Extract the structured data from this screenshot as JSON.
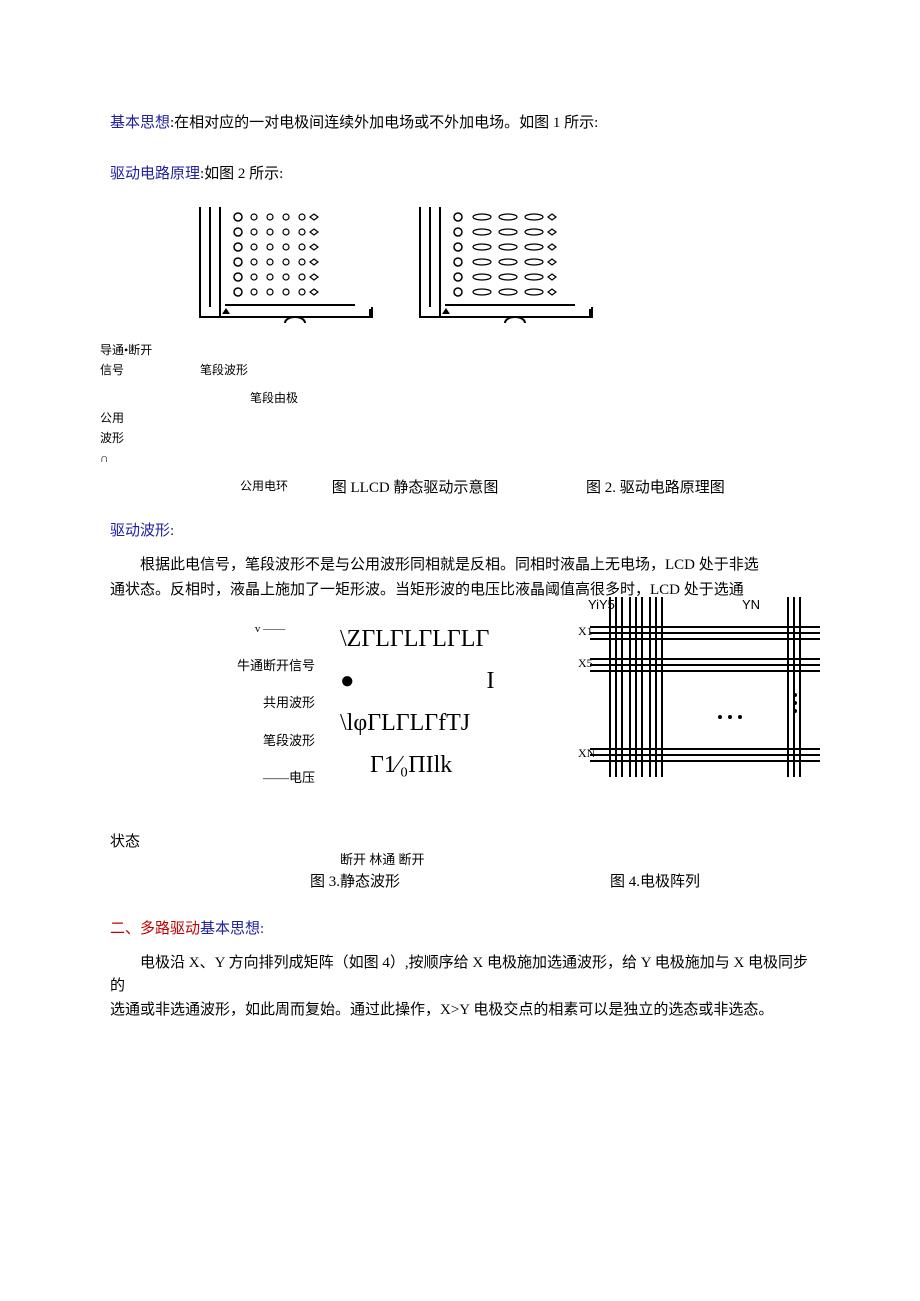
{
  "p1": {
    "label": "基本思想",
    "text": ":在相对应的一对电极间连续外加电场或不外加电场。如图 1 所示:"
  },
  "p2": {
    "label": "驱动电路原理",
    "text": ":如图 2 所示:"
  },
  "below": {
    "l1a": "导通•断开",
    "l1b": "信号",
    "l2": "笔段波形",
    "l3a": "公用",
    "l3b": "波形",
    "l3c": "∩",
    "l4": "笔段由极"
  },
  "caption12": {
    "gongyong": "公用电环",
    "c1": "图 LLCD 静态驱动示意图",
    "c2": "图 2. 驱动电路原理图"
  },
  "p3": "驱动波形:",
  "p4": "根据此电信号，笔段波形不是与公用波形同相就是反相。同相时液晶上无电场，LCD 处于非选",
  "p4b": "通状态。反相时，液晶上施加了一矩形波。当矩形波的电压比液晶阈值高很多时，LCD 处于选通",
  "fig3": {
    "top_v": "v ——",
    "l1": "牛通断开信号",
    "l2": "共用波形",
    "l3": "笔段波形",
    "l4": "——电压",
    "state": "状态",
    "sym1": "\\ΖΓLΓLΓLΓLΓ",
    "dot": "●",
    "sym_i": "I",
    "sym2": "\\lφΓLΓLΓfTJ",
    "sym3": "Γ1⁄₀ΠIlk",
    "break_label": "断开 林通 断开",
    "y_left": "YiY5",
    "y_right": "YN",
    "x1": "X1",
    "x5": "X5",
    "xn": "XN"
  },
  "caption34": {
    "c3": "图 3.静态波形",
    "c4": "图 4.电极阵列"
  },
  "p5": {
    "red": "二、多路驱动",
    "blue": "基本思想:"
  },
  "p6": "电极沿 X、Y 方向排列成矩阵（如图 4）,按顺序给 X 电极施加选通波形，给 Y 电极施加与 X 电极同步的",
  "p6b": "选通或非选通波形，如此周而复始。通过此操作，X>Y 电极交点的相素可以是独立的选态或非选态。"
}
